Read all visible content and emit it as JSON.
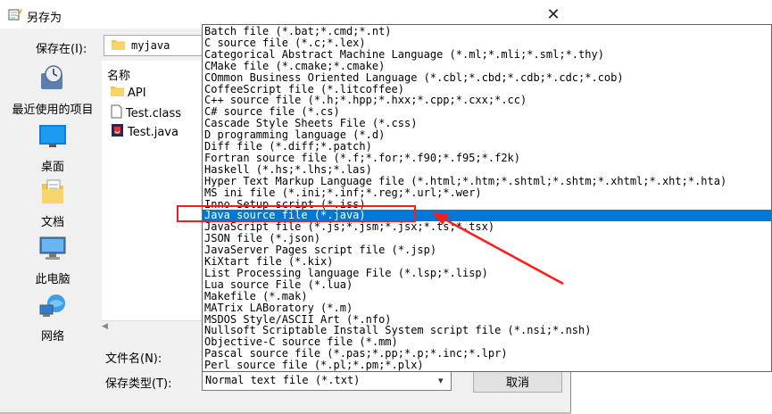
{
  "window": {
    "title": "另存为"
  },
  "toolbar": {
    "save_in_label": "保存在(I):",
    "location": "myjava"
  },
  "places": [
    {
      "label": "最近使用的项目",
      "icon": "recent-items-icon"
    },
    {
      "label": "桌面",
      "icon": "desktop-icon"
    },
    {
      "label": "文档",
      "icon": "documents-icon"
    },
    {
      "label": "此电脑",
      "icon": "this-pc-icon"
    },
    {
      "label": "网络",
      "icon": "network-icon"
    }
  ],
  "filelist": {
    "column_name": "名称",
    "items": [
      {
        "name": "API",
        "icon": "folder-icon"
      },
      {
        "name": "Test.class",
        "icon": "file-icon"
      },
      {
        "name": "Test.java",
        "icon": "java-file-icon"
      }
    ]
  },
  "form": {
    "filename_label": "文件名(N):",
    "filename_value": "",
    "filetype_label": "保存类型(T):",
    "filetype_value": "Normal text file (*.txt)",
    "cancel_label": "取消"
  },
  "dropdown": {
    "selected_index": 16,
    "options": [
      "Batch file (*.bat;*.cmd;*.nt)",
      "C source file (*.c;*.lex)",
      "Categorical Abstract Machine Language (*.ml;*.mli;*.sml;*.thy)",
      "CMake file (*.cmake;*.cmake)",
      "COmmon Business Oriented Language (*.cbl;*.cbd;*.cdb;*.cdc;*.cob)",
      "CoffeeScript file (*.litcoffee)",
      "C++ source file (*.h;*.hpp;*.hxx;*.cpp;*.cxx;*.cc)",
      "C# source file (*.cs)",
      "Cascade Style Sheets File (*.css)",
      "D programming language (*.d)",
      "Diff file (*.diff;*.patch)",
      "Fortran source file (*.f;*.for;*.f90;*.f95;*.f2k)",
      "Haskell (*.hs;*.lhs;*.las)",
      "Hyper Text Markup Language file (*.html;*.htm;*.shtml;*.shtm;*.xhtml;*.xht;*.hta)",
      "MS ini file (*.ini;*.inf;*.reg;*.url;*.wer)",
      "Inno Setup script (*.iss)",
      "Java source file (*.java)",
      "JavaScript file (*.js;*.jsm;*.jsx;*.ts;*.tsx)",
      "JSON file (*.json)",
      "JavaServer Pages script file (*.jsp)",
      "KiXtart file (*.kix)",
      "List Processing language File (*.lsp;*.lisp)",
      "Lua source File (*.lua)",
      "Makefile (*.mak)",
      "MATrix LABoratory (*.m)",
      "MSDOS Style/ASCII Art (*.nfo)",
      "Nullsoft Scriptable Install System script file (*.nsi;*.nsh)",
      "Objective-C source file (*.mm)",
      "Pascal source file (*.pas;*.pp;*.p;*.inc;*.lpr)",
      "Perl source file (*.pl;*.pm;*.plx)"
    ]
  },
  "colors": {
    "selection": "#0078d7",
    "annotation": "#ff1a1a"
  }
}
